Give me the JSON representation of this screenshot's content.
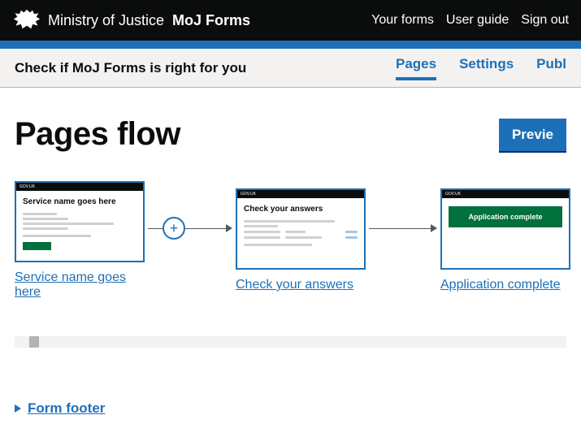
{
  "header": {
    "ministry": "Ministry of Justice",
    "app": "MoJ Forms",
    "nav": {
      "forms": "Your forms",
      "guide": "User guide",
      "signout": "Sign out"
    }
  },
  "subheader": {
    "title": "Check if MoJ Forms is right for you",
    "tabs": {
      "pages": "Pages",
      "settings": "Settings",
      "publish": "Publ"
    }
  },
  "main": {
    "title": "Pages flow",
    "preview": "Previe"
  },
  "flow": {
    "govuk": "GOV.UK",
    "items": [
      {
        "thumb_title": "Service name goes here",
        "link": "Service name goes here"
      },
      {
        "thumb_title": "Check your answers",
        "link": "Check your answers"
      },
      {
        "thumb_title": "Application complete",
        "link": "Application complete"
      }
    ]
  },
  "footer": {
    "toggle": "Form footer"
  }
}
